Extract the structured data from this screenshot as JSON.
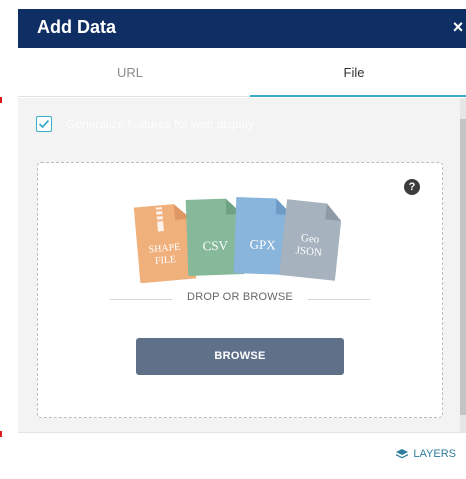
{
  "dialog": {
    "title": "Add Data",
    "close_label": "×"
  },
  "tabs": [
    {
      "label": "URL",
      "active": false
    },
    {
      "label": "File",
      "active": true
    }
  ],
  "options": {
    "generalize_label": "Generalize features for web display",
    "generalize_checked": true
  },
  "dropzone": {
    "help_label": "?",
    "file_types": [
      {
        "line1": "SHAPE",
        "line2": "FILE",
        "color": "#f0b07c"
      },
      {
        "line1": "CSV",
        "line2": "",
        "color": "#86b89a"
      },
      {
        "line1": "GPX",
        "line2": "",
        "color": "#89b4dc"
      },
      {
        "line1": "Geo",
        "line2": "JSON",
        "color": "#a6b2bd"
      }
    ],
    "drop_text": "DROP OR BROWSE",
    "browse_label": "BROWSE"
  },
  "footer": {
    "layers_label": "LAYERS"
  },
  "colors": {
    "header_bg": "#0f2f64",
    "accent": "#3aaec9",
    "button_bg": "#5f7089"
  }
}
